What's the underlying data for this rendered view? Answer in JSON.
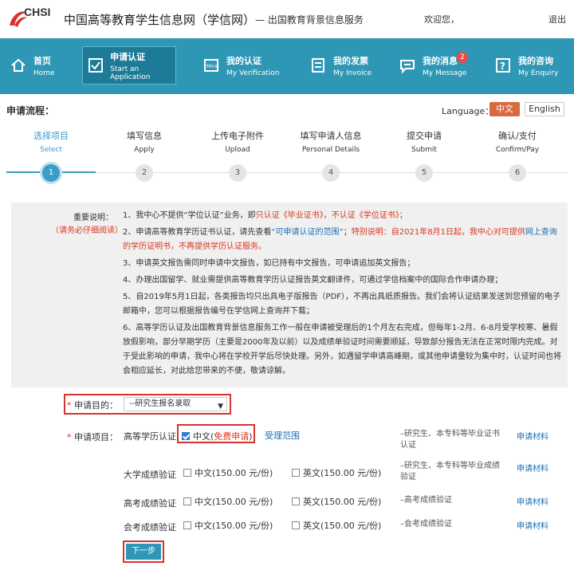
{
  "header": {
    "logo_text": "CHSI",
    "site_title": "中国高等教育学生信息网（学信网）",
    "site_sub": "— 出国教育背景信息服务",
    "welcome": "欢迎您，",
    "logout": "退出"
  },
  "nav": [
    {
      "zh": "首页",
      "en": "Home",
      "icon": "home-icon"
    },
    {
      "zh": "申请认证",
      "en": "Start an Application",
      "icon": "check-icon",
      "active": true
    },
    {
      "zh": "我的认证",
      "en": "My Verification",
      "icon": "mine-icon"
    },
    {
      "zh": "我的发票",
      "en": "My Invoice",
      "icon": "invoice-icon"
    },
    {
      "zh": "我的消息",
      "en": "My Message",
      "icon": "message-icon",
      "badge": "2"
    },
    {
      "zh": "我的咨询",
      "en": "My Enquiry",
      "icon": "question-icon"
    }
  ],
  "process": {
    "label": "申请流程：",
    "language_label": "Language：",
    "lang_zh": "中文",
    "lang_en": "English",
    "steps": [
      {
        "zh": "选择项目",
        "en": "Select",
        "num": "1"
      },
      {
        "zh": "填写信息",
        "en": "Apply",
        "num": "2"
      },
      {
        "zh": "上传电子附件",
        "en": "Upload",
        "num": "3"
      },
      {
        "zh": "填写申请人信息",
        "en": "Personal Details",
        "num": "4"
      },
      {
        "zh": "提交申请",
        "en": "Submit",
        "num": "5"
      },
      {
        "zh": "确认/支付",
        "en": "Confirm/Pay",
        "num": "6"
      }
    ]
  },
  "notice": {
    "title": "重要说明：",
    "sub": "（请务必仔细阅读）",
    "p1_a": "1、我中心不提供“学位认证”业务，即",
    "p1_b": "只认证《毕业证书》，不认证《学位证书》；",
    "p2_a": "2、申请高等教育学历证书认证，请先查看",
    "p2_b": "“可申请认证的范围”",
    "p2_c": "；",
    "p2_d": "特别说明：自2021年8月1日起，我中心对可提供",
    "p2_e": "网上查询",
    "p2_f": "的学历证明书，不再提供学历认证服务。",
    "p3": "3、申请英文报告需同时申请中文报告，如已持有中文报告，可申请追加英文报告；",
    "p4": "4、办理出国留学、就业需提供高等教育学历认证报告英文翻译件，可通过学信档案中的国际合作申请办理；",
    "p5": "5、自2019年5月1日起，各类报告均只出具电子版报告（PDF），不再出具纸质报告。我们会将认证结果发送到您预留的电子邮箱中，您可以根据报告编号在学信网上查询并下载；",
    "p6": "6、高等学历认证及出国教育背景信息服务工作一般在申请被受理后的1个月左右完成，但每年1-2月、6-8月受学校寒、暑假放假影响，部分早期学历（主要是2000年及以前）以及成绩单验证时间需要顺延，导致部分报告无法在正常时限内完成。对于受此影响的申请，我中心将在学校开学后尽快处理。另外，如遇留学申请高峰期，或其他申请量较为集中时，认证时间也将会相应延长，对此给您带来的不便，敬请谅解。"
  },
  "form": {
    "purpose_label": "申请目的：",
    "purpose_value": "--研究生报名录取",
    "items_label": "申请项目：",
    "star": "*",
    "range_link": "受理范围",
    "rows": [
      {
        "label": "高等学历认证",
        "zh": "中文(",
        "zh_free": "免费申请",
        "zh_end": ")",
        "desc": "–研究生、本专科等毕业证书认证",
        "mat": "申请材料"
      },
      {
        "label": "大学成绩验证",
        "zh": "中文(150.00 元/份)",
        "en": "英文(150.00 元/份)",
        "desc": "–研究生、本专科等毕业成绩验证",
        "mat": "申请材料"
      },
      {
        "label": "高考成绩验证",
        "zh": "中文(150.00 元/份)",
        "en": "英文(150.00 元/份)",
        "desc": "–高考成绩验证",
        "mat": "申请材料"
      },
      {
        "label": "会考成绩验证",
        "zh": "中文(150.00 元/份)",
        "en": "英文(150.00 元/份)",
        "desc": "–会考成绩验证",
        "mat": "申请材料"
      }
    ],
    "next": "下一步"
  }
}
